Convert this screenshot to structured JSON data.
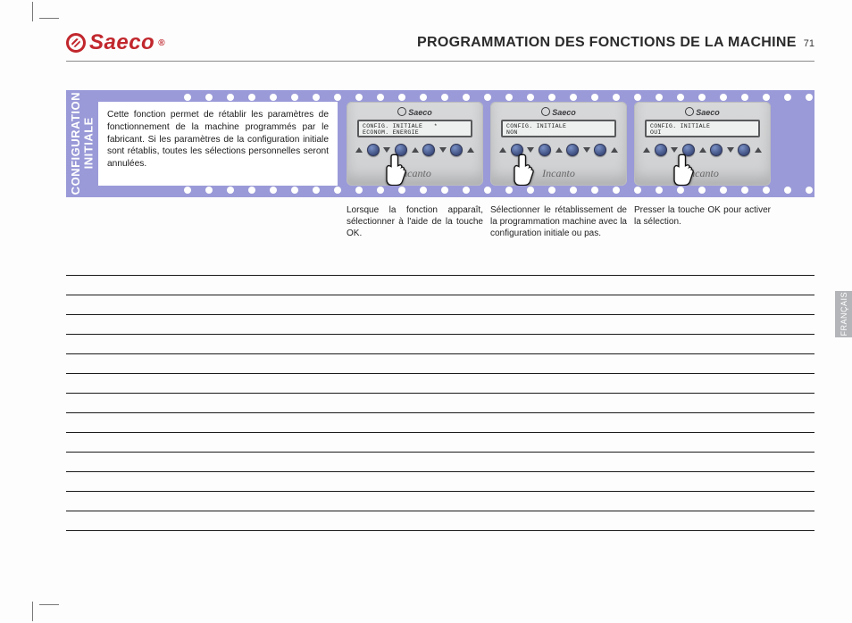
{
  "header": {
    "logo_text": "Saeco",
    "logo_suffix": "®",
    "section_title": "PROGRAMMATION DES FONCTIONS DE LA MACHINE",
    "page_number": "71"
  },
  "side_label": "CONFIGURATION\nINITIALE",
  "intro": "Cette fonction permet de rétablir les paramètres de fonctionnement de la machine programmés par le fabricant. Si les paramètres de la configuration initiale sont rétablis, toutes les sélections personnelles seront annulées.",
  "panels": [
    {
      "brand": "Saeco",
      "lcd_line1": "CONFIG. INITIALE   *",
      "lcd_line2": "ECONOM. ENERGIE",
      "model": "Incanto",
      "hand_target": "ok",
      "caption": "Lorsque la fonction apparaît, sélectionner à l'aide de la touche OK."
    },
    {
      "brand": "Saeco",
      "lcd_line1": "CONFIG. INITIALE",
      "lcd_line2": "NON",
      "model": "Incanto",
      "hand_target": "arrow",
      "caption": "Sélectionner le rétablissement de la programmation machine avec la configuration initiale ou pas."
    },
    {
      "brand": "Saeco",
      "lcd_line1": "CONFIG. INITIALE",
      "lcd_line2": "OUI",
      "model": "Incanto",
      "hand_target": "ok",
      "caption": "Presser la touche OK pour activer la sélection."
    }
  ],
  "language_tab": "FRANÇAIS",
  "ruled_line_count": 14
}
